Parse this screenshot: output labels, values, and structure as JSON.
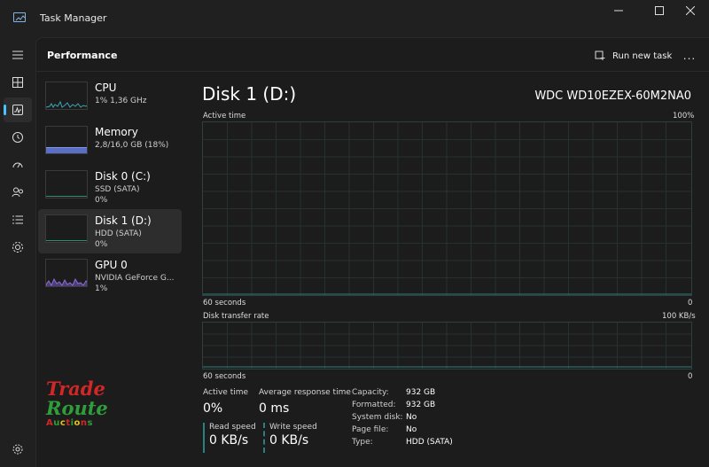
{
  "window": {
    "title": "Task Manager"
  },
  "header": {
    "page_title": "Performance",
    "run_new_task": "Run new task",
    "more": "..."
  },
  "nav": {
    "items": [
      {
        "icon": "hamburger-icon"
      },
      {
        "icon": "processes-icon"
      },
      {
        "icon": "performance-icon",
        "active": true
      },
      {
        "icon": "app-history-icon"
      },
      {
        "icon": "startup-apps-icon"
      },
      {
        "icon": "users-icon"
      },
      {
        "icon": "details-icon"
      },
      {
        "icon": "services-icon"
      },
      {
        "icon": "settings-icon"
      }
    ]
  },
  "sidebar": {
    "items": [
      {
        "name": "CPU",
        "sub1": "1%  1,36 GHz",
        "sub2": "",
        "color": "#3aa6b5"
      },
      {
        "name": "Memory",
        "sub1": "2,8/16,0 GB (18%)",
        "sub2": "",
        "color": "#6b7fc9"
      },
      {
        "name": "Disk 0 (C:)",
        "sub1": "SSD (SATA)",
        "sub2": "0%",
        "color": "#2f8f6f"
      },
      {
        "name": "Disk 1 (D:)",
        "sub1": "HDD (SATA)",
        "sub2": "0%",
        "color": "#2f8f6f"
      },
      {
        "name": "GPU 0",
        "sub1": "NVIDIA GeForce G...",
        "sub2": "1%",
        "color": "#8a6fd0"
      }
    ]
  },
  "detail": {
    "title": "Disk 1 (D:)",
    "model": "WDC WD10EZEX-60M2NA0",
    "graph1": {
      "label": "Active time",
      "max": "100%",
      "time": "60 seconds",
      "min": "0"
    },
    "graph2": {
      "label": "Disk transfer rate",
      "max": "100 KB/s",
      "time": "60 seconds",
      "min": "0"
    },
    "stats": {
      "active_time_label": "Active time",
      "active_time_value": "0%",
      "avg_response_label": "Average response time",
      "avg_response_value": "0 ms",
      "read_speed_label": "Read speed",
      "read_speed_value": "0 KB/s",
      "write_speed_label": "Write speed",
      "write_speed_value": "0 KB/s"
    },
    "properties": [
      {
        "key": "Capacity:",
        "value": "932 GB"
      },
      {
        "key": "Formatted:",
        "value": "932 GB"
      },
      {
        "key": "System disk:",
        "value": "No"
      },
      {
        "key": "Page file:",
        "value": "No"
      },
      {
        "key": "Type:",
        "value": "HDD (SATA)"
      }
    ]
  },
  "watermark": {
    "line1": "Trade",
    "line2": "Route",
    "line3": "Auctions"
  },
  "colors": {
    "accent": "#4cc2ff",
    "disk_graph": "#2a7f7f"
  }
}
